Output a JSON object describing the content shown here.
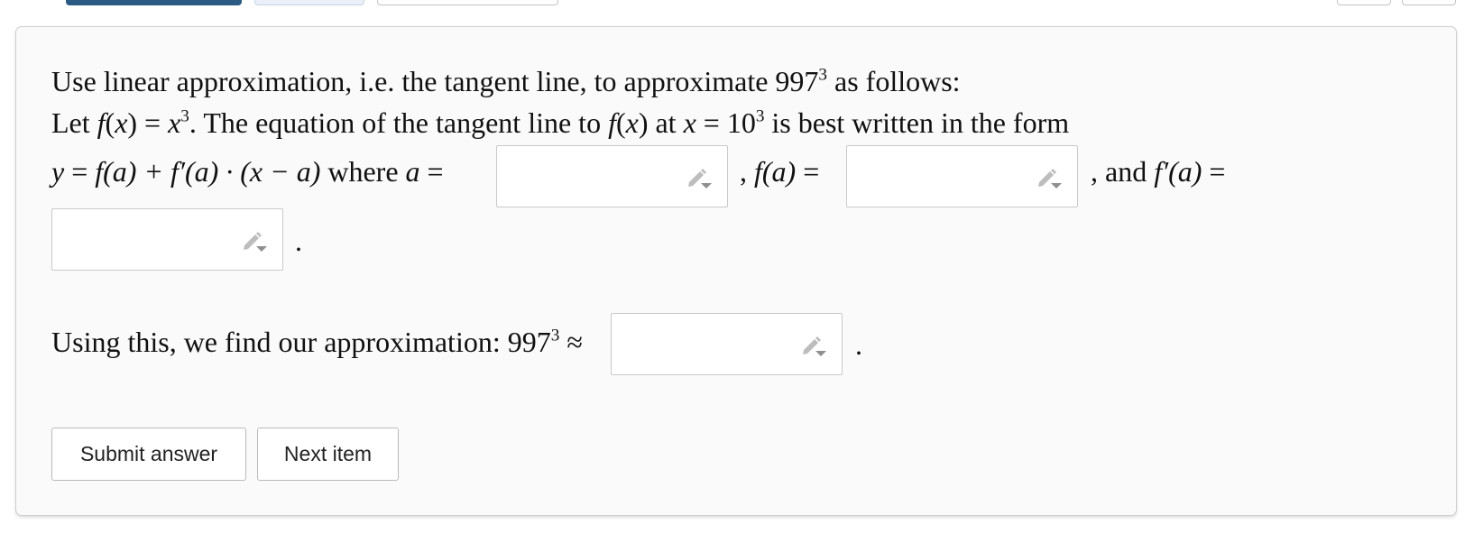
{
  "question": {
    "line1": {
      "text": "Use linear approximation, i.e. the tangent line, to approximate 997",
      "exp": "3",
      "tail": " as follows:"
    },
    "line2": {
      "let": "Let ",
      "f": "f",
      "x": "x",
      "exp": "3",
      "mid": ". The equation of the tangent line to ",
      "at": " at ",
      "eq": " = 10",
      "tail": " is best written in the form"
    },
    "line3": {
      "y": "y",
      "form_eq": " = ",
      "form_rest": "(a) + ",
      "fp": "f′",
      "form_rest2": "(a) · (x − a)",
      "where": " where ",
      "a": "a",
      "eq": " =",
      "f_label": "f(a)",
      "and": ", and ",
      "fp_label": "f′(a)"
    },
    "period": ".",
    "comma": ",",
    "approx_line": {
      "text": "Using this, we find our approximation: 997",
      "exp": "3",
      "approx": " ≈"
    }
  },
  "answers": [
    {
      "value": "",
      "icon": "pencil-dropdown-icon"
    },
    {
      "value": "",
      "icon": "pencil-dropdown-icon"
    },
    {
      "value": "",
      "icon": "pencil-dropdown-icon"
    },
    {
      "value": "",
      "icon": "pencil-dropdown-icon"
    }
  ],
  "buttons": {
    "submit": "Submit answer",
    "next": "Next item"
  },
  "colors": {
    "primary": "#2b5a84",
    "card_bg": "#fafafa",
    "border": "#c9c9c9"
  }
}
